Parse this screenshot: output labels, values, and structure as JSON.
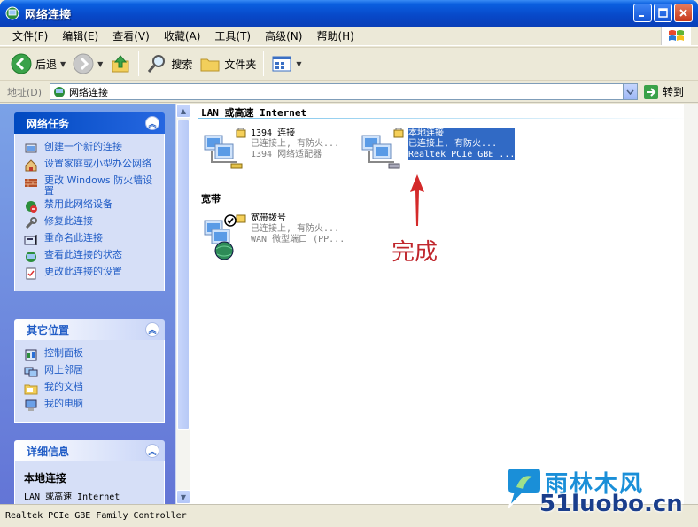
{
  "window": {
    "title": "网络连接"
  },
  "menu": [
    "文件(F)",
    "编辑(E)",
    "查看(V)",
    "收藏(A)",
    "工具(T)",
    "高级(N)",
    "帮助(H)"
  ],
  "toolbar": {
    "back": "后退",
    "search": "搜索",
    "folders": "文件夹"
  },
  "address": {
    "label": "地址(D)",
    "value": "网络连接",
    "go": "转到"
  },
  "taskpane": {
    "network_tasks": {
      "title": "网络任务",
      "items": [
        "创建一个新的连接",
        "设置家庭或小型办公网络",
        "更改 Windows 防火墙设置",
        "禁用此网络设备",
        "修复此连接",
        "重命名此连接",
        "查看此连接的状态",
        "更改此连接的设置"
      ]
    },
    "other_places": {
      "title": "其它位置",
      "items": [
        "控制面板",
        "网上邻居",
        "我的文档",
        "我的电脑"
      ]
    },
    "details": {
      "title": "详细信息",
      "name": "本地连接",
      "type": "LAN 或高速 Internet"
    }
  },
  "main": {
    "section_lan": "LAN 或高速 Internet",
    "section_broadband": "宽带",
    "connections": [
      {
        "name": "1394 连接",
        "status": "已连接上, 有防火...",
        "device": "1394 网络适配器"
      },
      {
        "name": "本地连接",
        "status": "已连接上, 有防火...",
        "device": "Realtek PCIe GBE ..."
      },
      {
        "name": "宽带拨号",
        "status": "已连接上, 有防火...",
        "device": "WAN 微型端口 (PP..."
      }
    ],
    "annotation": "完成"
  },
  "status": {
    "text": "Realtek PCIe GBE Family Controller"
  },
  "watermark": {
    "line1": "雨林木风",
    "line2": "51luobo.cn"
  },
  "colors": {
    "title_bar": "#0848C8",
    "task_link": "#215DC6",
    "selection": "#316AC5",
    "annotation": "#C0272D"
  }
}
